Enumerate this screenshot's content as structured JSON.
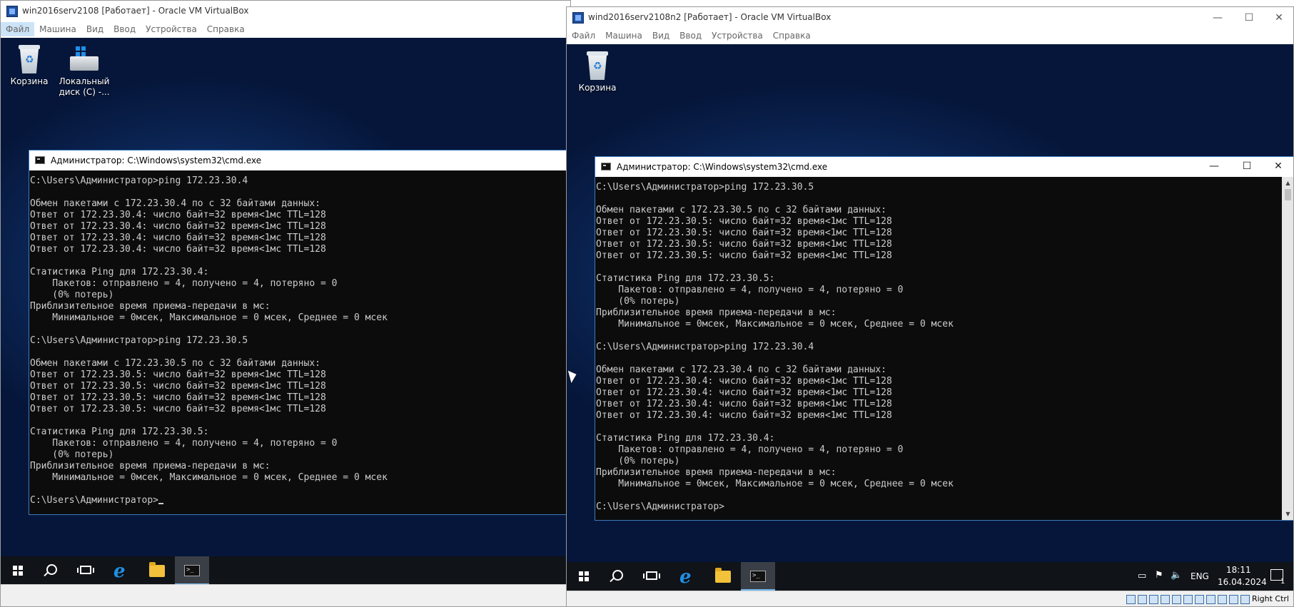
{
  "vm1": {
    "title": "win2016serv2108 [Работает] - Oracle VM VirtualBox",
    "menu": [
      "Файл",
      "Машина",
      "Вид",
      "Ввод",
      "Устройства",
      "Справка"
    ],
    "desktop_icons": [
      "Корзина",
      "Локальный диск (C) -..."
    ],
    "cmd_title": "Администратор: C:\\Windows\\system32\\cmd.exe",
    "console_lines": [
      "C:\\Users\\Администратор>ping 172.23.30.4",
      "",
      "Обмен пакетами с 172.23.30.4 по с 32 байтами данных:",
      "Ответ от 172.23.30.4: число байт=32 время<1мс TTL=128",
      "Ответ от 172.23.30.4: число байт=32 время<1мс TTL=128",
      "Ответ от 172.23.30.4: число байт=32 время<1мс TTL=128",
      "Ответ от 172.23.30.4: число байт=32 время<1мс TTL=128",
      "",
      "Статистика Ping для 172.23.30.4:",
      "    Пакетов: отправлено = 4, получено = 4, потеряно = 0",
      "    (0% потерь)",
      "Приблизительное время приема-передачи в мс:",
      "    Минимальное = 0мсек, Максимальное = 0 мсек, Среднее = 0 мсек",
      "",
      "C:\\Users\\Администратор>ping 172.23.30.5",
      "",
      "Обмен пакетами с 172.23.30.5 по с 32 байтами данных:",
      "Ответ от 172.23.30.5: число байт=32 время<1мс TTL=128",
      "Ответ от 172.23.30.5: число байт=32 время<1мс TTL=128",
      "Ответ от 172.23.30.5: число байт=32 время<1мс TTL=128",
      "Ответ от 172.23.30.5: число байт=32 время<1мс TTL=128",
      "",
      "Статистика Ping для 172.23.30.5:",
      "    Пакетов: отправлено = 4, получено = 4, потеряно = 0",
      "    (0% потерь)",
      "Приблизительное время приема-передачи в мс:",
      "    Минимальное = 0мсек, Максимальное = 0 мсек, Среднее = 0 мсек",
      ""
    ],
    "prompt": "C:\\Users\\Администратор>"
  },
  "vm2": {
    "title": "wind2016serv2108n2 [Работает] - Oracle VM VirtualBox",
    "menu": [
      "Файл",
      "Машина",
      "Вид",
      "Ввод",
      "Устройства",
      "Справка"
    ],
    "desktop_icons": [
      "Корзина"
    ],
    "cmd_title": "Администратор: C:\\Windows\\system32\\cmd.exe",
    "console_lines": [
      "C:\\Users\\Администратор>ping 172.23.30.5",
      "",
      "Обмен пакетами с 172.23.30.5 по с 32 байтами данных:",
      "Ответ от 172.23.30.5: число байт=32 время<1мс TTL=128",
      "Ответ от 172.23.30.5: число байт=32 время<1мс TTL=128",
      "Ответ от 172.23.30.5: число байт=32 время<1мс TTL=128",
      "Ответ от 172.23.30.5: число байт=32 время<1мс TTL=128",
      "",
      "Статистика Ping для 172.23.30.5:",
      "    Пакетов: отправлено = 4, получено = 4, потеряно = 0",
      "    (0% потерь)",
      "Приблизительное время приема-передачи в мс:",
      "    Минимальное = 0мсек, Максимальное = 0 мсек, Среднее = 0 мсек",
      "",
      "C:\\Users\\Администратор>ping 172.23.30.4",
      "",
      "Обмен пакетами с 172.23.30.4 по с 32 байтами данных:",
      "Ответ от 172.23.30.4: число байт=32 время<1мс TTL=128",
      "Ответ от 172.23.30.4: число байт=32 время<1мс TTL=128",
      "Ответ от 172.23.30.4: число байт=32 время<1мс TTL=128",
      "Ответ от 172.23.30.4: число байт=32 время<1мс TTL=128",
      "",
      "Статистика Ping для 172.23.30.4:",
      "    Пакетов: отправлено = 4, получено = 4, потеряно = 0",
      "    (0% потерь)",
      "Приблизительное время приема-передачи в мс:",
      "    Минимальное = 0мсек, Максимальное = 0 мсек, Среднее = 0 мсек",
      ""
    ],
    "prompt": "C:\\Users\\Администратор>",
    "tray": {
      "lang": "ENG",
      "time": "18:11",
      "date": "16.04.2024",
      "notifications": "1"
    },
    "statusbar_host_key": "Right Ctrl"
  },
  "colors": {
    "console_bg": "#0c0c0c",
    "console_text": "#cccccc",
    "taskbar": "#101317",
    "accent": "#76b9ed"
  }
}
